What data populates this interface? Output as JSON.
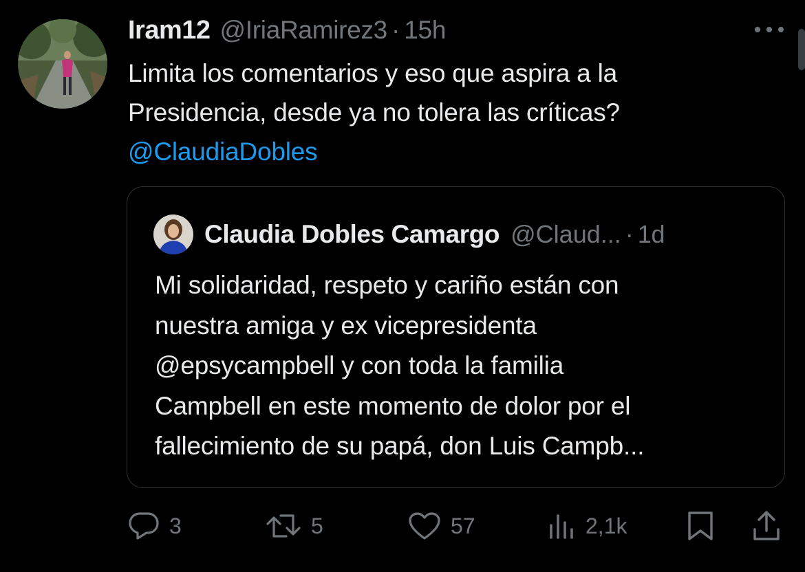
{
  "tweet": {
    "author_name": "Iram12",
    "author_handle": "@IriaRamirez3",
    "separator": "·",
    "time": "15h",
    "text_lines": [
      "Limita los comentarios y eso que aspira a la",
      "Presidencia, desde ya no tolera las críticas?"
    ],
    "mention": "@ClaudiaDobles",
    "more_icon": "more-horizontal-icon"
  },
  "quote": {
    "author_name": "Claudia Dobles Camargo",
    "author_handle": "@Claud...",
    "separator": "·",
    "time": "1d",
    "text_lines": [
      "Mi solidaridad, respeto y cariño están con",
      "nuestra amiga y ex vicepresidenta",
      "@epsycampbell  y con toda la familia",
      "Campbell en este momento de dolor por el",
      "fallecimiento de su papá, don Luis Campb..."
    ]
  },
  "actions": {
    "replies": "3",
    "retweets": "5",
    "likes": "57",
    "views": "2,1k"
  },
  "colors": {
    "background": "#000000",
    "text": "#e7e9ea",
    "secondary": "#71767b",
    "accent": "#1d9bf0",
    "border": "#2f3336"
  }
}
